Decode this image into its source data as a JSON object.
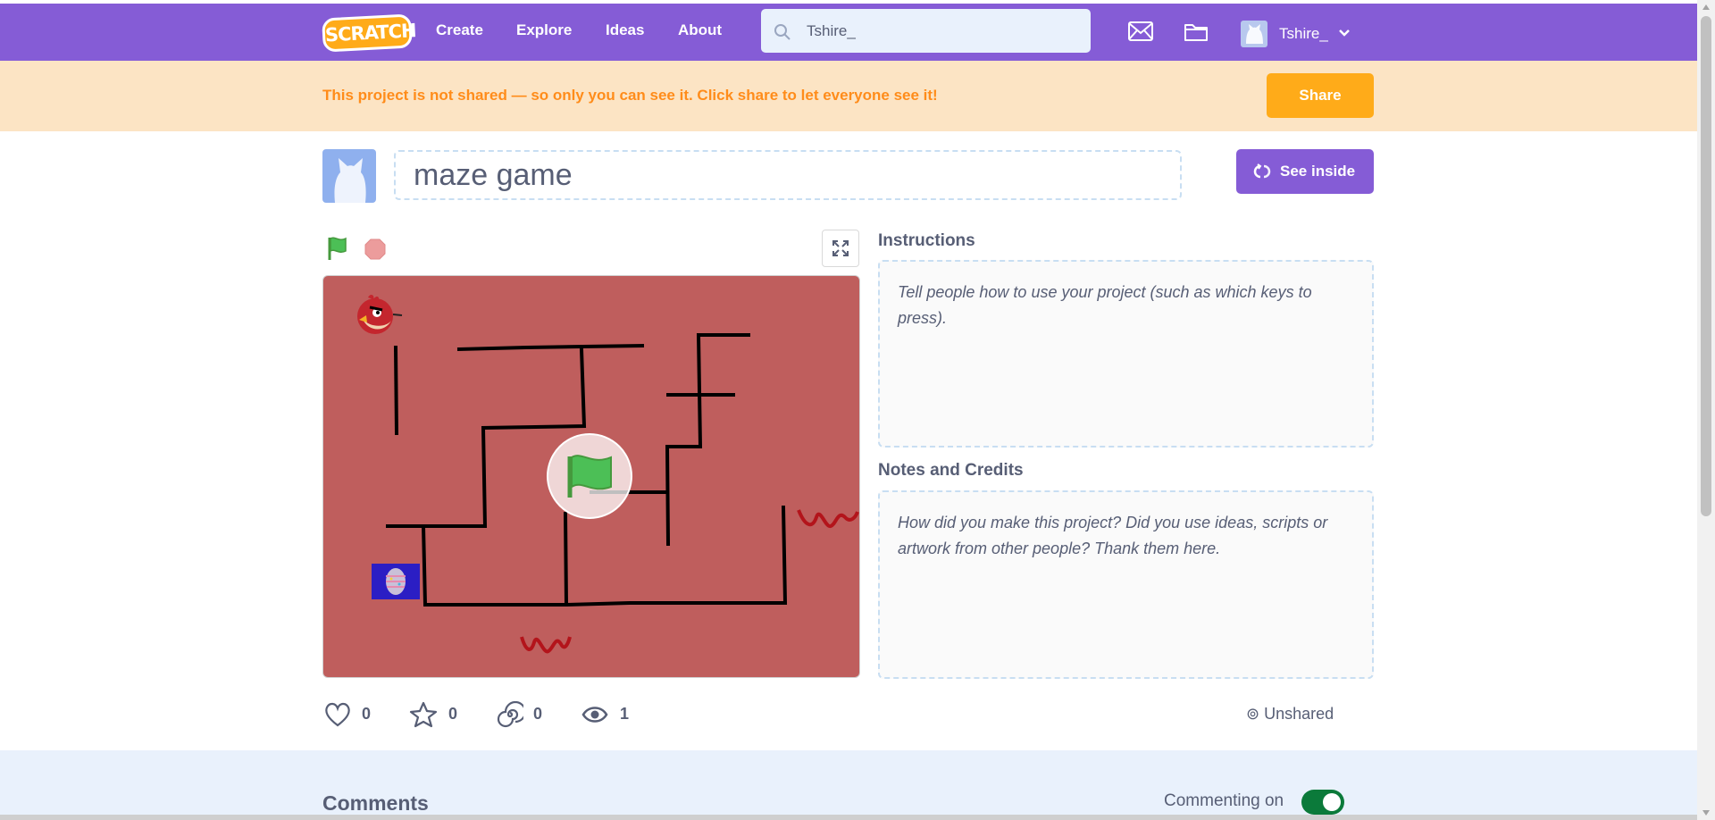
{
  "nav": {
    "logo": "SCRATCH",
    "links": [
      "Create",
      "Explore",
      "Ideas",
      "About"
    ],
    "search_value": "Tshire_",
    "username": "Tshire_"
  },
  "banner": {
    "text": "This project is not shared — so only you can see it. Click share to let everyone see it!",
    "share_label": "Share"
  },
  "project": {
    "title": "maze game",
    "see_inside_label": "See inside"
  },
  "instructions": {
    "label": "Instructions",
    "placeholder": "Tell people how to use your project (such as which keys to press)."
  },
  "notes": {
    "label": "Notes and Credits",
    "placeholder": "How did you make this project? Did you use ideas, scripts or artwork from other people? Thank them here."
  },
  "stats": {
    "loves": "0",
    "favorites": "0",
    "remixes": "0",
    "views": "1",
    "status": "Unshared"
  },
  "comments": {
    "title": "Comments",
    "commenting_label": "Commenting on",
    "commenting_on": true
  },
  "colors": {
    "brand_purple": "#855cd6",
    "banner_bg": "#fce4c4",
    "banner_text": "#ff8c1a",
    "share": "#ffab19",
    "stage_bg": "#bf5e5d",
    "toggle_on": "#0b7a3a"
  },
  "icons": [
    "search-icon",
    "messages-icon",
    "my-stuff-icon",
    "chevron-down-icon",
    "remix-icon",
    "green-flag-icon",
    "stop-icon",
    "fullscreen-icon",
    "heart-icon",
    "star-icon",
    "remix-spiral-icon",
    "eye-icon"
  ]
}
